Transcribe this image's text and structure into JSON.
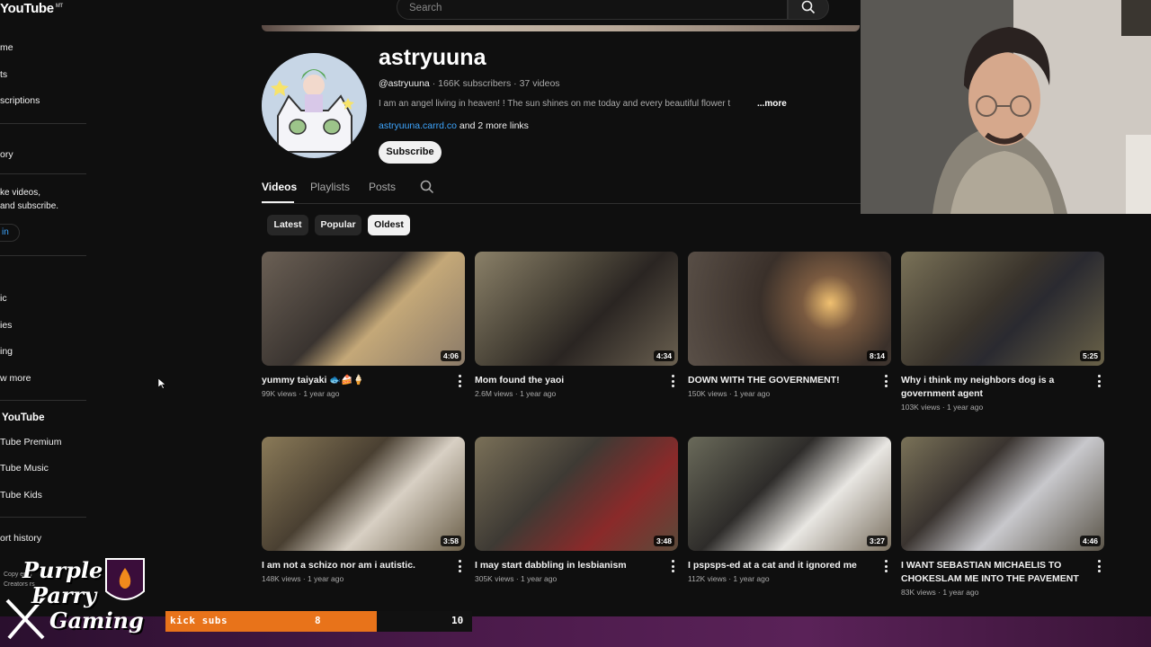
{
  "sidebar": {
    "logo": "YouTube",
    "logo_sup": "MT",
    "items": [
      "me",
      "ts",
      "scriptions",
      "ory"
    ],
    "signin_prompt_line1": "ke videos,",
    "signin_prompt_line2": "and subscribe.",
    "signin_label": "in",
    "explore_items": [
      "ic",
      "ies",
      "ing",
      "w more"
    ],
    "more_heading": "YouTube",
    "more_items": [
      "Tube Premium",
      "Tube Music",
      "Tube Kids"
    ],
    "footer_item": "ort history",
    "copyright_line1": "Copy    ertis",
    "copyright_line2": "Creators    rs"
  },
  "header": {
    "search_placeholder": "Search"
  },
  "channel": {
    "name": "astryuuna",
    "handle": "@astryuuna",
    "subscribers": "166K subscribers",
    "videos_count": "37 videos",
    "description": "I am an angel living in heaven! ! The sun shines on me today and every beautiful flower t",
    "more_label": "...more",
    "link": "astryuuna.carrd.co",
    "more_links": "and 2 more links",
    "subscribe_label": "Subscribe"
  },
  "tabs": [
    {
      "label": "Videos",
      "active": true
    },
    {
      "label": "Playlists",
      "active": false
    },
    {
      "label": "Posts",
      "active": false
    }
  ],
  "chips": [
    {
      "label": "Latest",
      "active": false
    },
    {
      "label": "Popular",
      "active": false
    },
    {
      "label": "Oldest",
      "active": true
    }
  ],
  "videos": [
    {
      "title": "yummy taiyaki 🐟🍰🍦",
      "views": "99K views",
      "age": "1 year ago",
      "duration": "4:06"
    },
    {
      "title": "Mom found the yaoi",
      "views": "2.6M views",
      "age": "1 year ago",
      "duration": "4:34"
    },
    {
      "title": "DOWN WITH THE GOVERNMENT!",
      "views": "150K views",
      "age": "1 year ago",
      "duration": "8:14"
    },
    {
      "title": "Why i think my neighbors dog is a government agent",
      "views": "103K views",
      "age": "1 year ago",
      "duration": "5:25"
    },
    {
      "title": "I am not a schizo nor am i autistic.",
      "views": "148K views",
      "age": "1 year ago",
      "duration": "3:58"
    },
    {
      "title": "I may start dabbling in lesbianism",
      "views": "305K views",
      "age": "1 year ago",
      "duration": "3:48"
    },
    {
      "title": "I pspsps-ed at a cat and it ignored me",
      "views": "112K views",
      "age": "1 year ago",
      "duration": "3:27"
    },
    {
      "title": "I WANT SEBASTIAN MICHAELIS TO CHOKESLAM ME INTO THE PAVEMENT",
      "views": "83K views",
      "age": "1 year ago",
      "duration": "4:46"
    }
  ],
  "overlay": {
    "logo_line1": "Purple",
    "logo_line2": "Parry",
    "logo_line3": "Gaming",
    "goal_label": "kick subs",
    "goal_current": "8",
    "goal_target": "10",
    "goal_progress": 0.8,
    "accent": "#e8731a"
  },
  "colors": {
    "background": "#0f0f0f",
    "link": "#3ea6ff"
  }
}
